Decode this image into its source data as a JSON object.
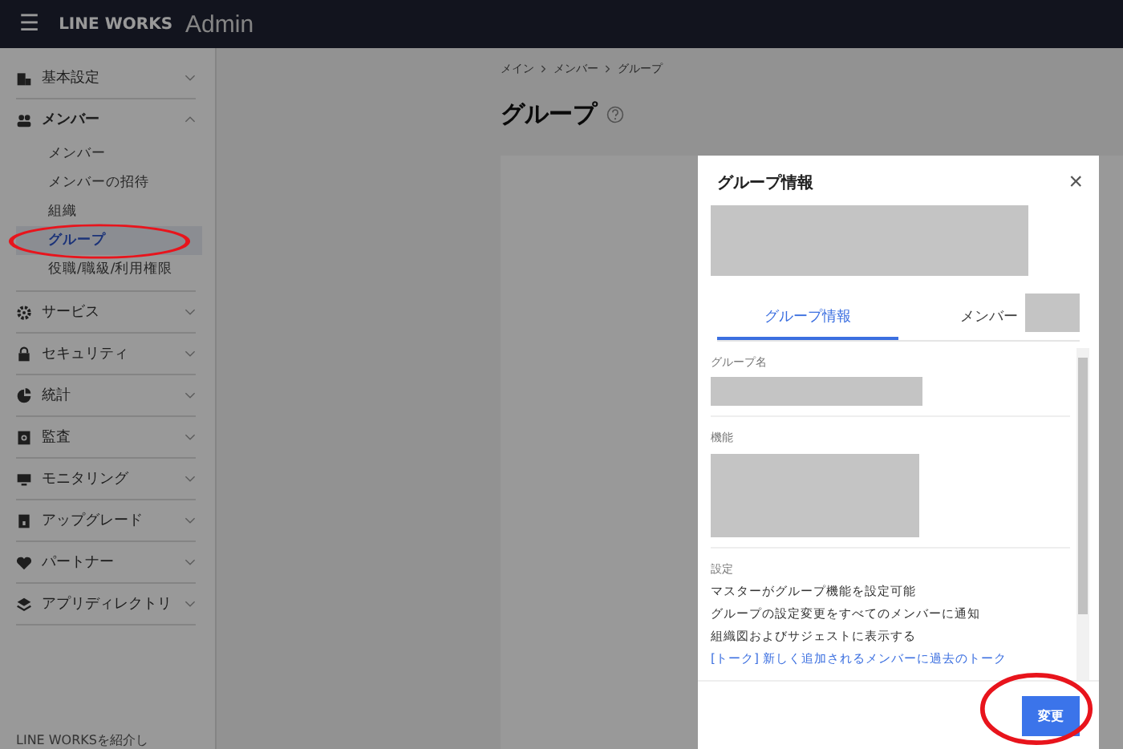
{
  "header": {
    "menu_icon": "☰",
    "brand": "LINE WORKS",
    "title": "Admin"
  },
  "sidebar": {
    "sections": [
      {
        "label": "基本設定",
        "expanded": false
      },
      {
        "label": "メンバー",
        "expanded": true,
        "children": [
          {
            "label": "メンバー",
            "selected": false
          },
          {
            "label": "メンバーの招待",
            "selected": false
          },
          {
            "label": "組織",
            "selected": false
          },
          {
            "label": "グループ",
            "selected": true
          },
          {
            "label": "役職/職級/利用権限",
            "selected": false
          }
        ]
      },
      {
        "label": "サービス",
        "expanded": false
      },
      {
        "label": "セキュリティ",
        "expanded": false
      },
      {
        "label": "統計",
        "expanded": false
      },
      {
        "label": "監査",
        "expanded": false
      },
      {
        "label": "モニタリング",
        "expanded": false
      },
      {
        "label": "アップグレード",
        "expanded": false
      },
      {
        "label": "パートナー",
        "expanded": false
      },
      {
        "label": "アプリディレクトリ",
        "expanded": false
      }
    ],
    "footer": "LINE WORKSを紹介し"
  },
  "breadcrumb": [
    "メイン",
    "メンバー",
    "グループ"
  ],
  "page_title": "グループ",
  "modal": {
    "title": "グループ情報",
    "close": "×",
    "tabs": [
      {
        "label": "グループ情報",
        "selected": true
      },
      {
        "label": "メンバー",
        "selected": false
      }
    ],
    "fields": [
      {
        "label": "グループ名"
      },
      {
        "label": "機能"
      }
    ],
    "settings_label": "設定",
    "settings": [
      {
        "text": "マスターがグループ機能を設定可能",
        "kind": "plain"
      },
      {
        "text": "グループの設定変更をすべてのメンバーに通知",
        "kind": "plain"
      },
      {
        "text": "組織図およびサジェストに表示する",
        "kind": "plain"
      },
      {
        "text": "[トーク] 新しく追加されるメンバーに過去のトーク",
        "kind": "link"
      }
    ],
    "button": "変更"
  }
}
